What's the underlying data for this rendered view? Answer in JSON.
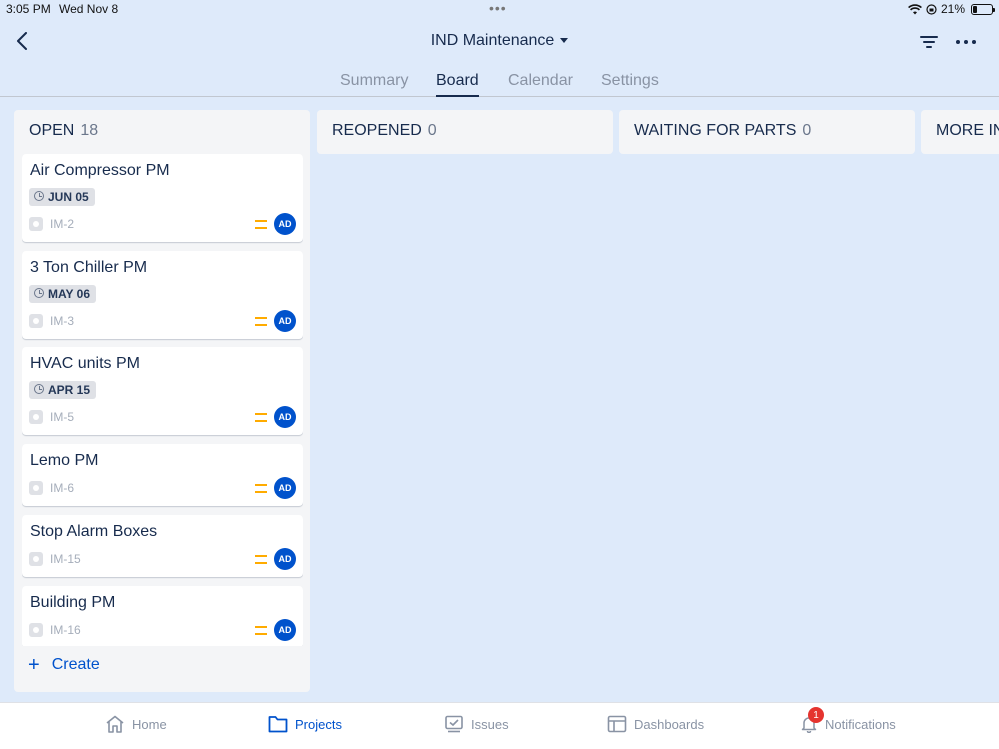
{
  "status_bar": {
    "time": "3:05 PM",
    "date": "Wed Nov 8",
    "dots": "•••",
    "battery_text": "21%",
    "battery_level": 0.21
  },
  "header": {
    "title": "IND Maintenance",
    "back_icon": "chevron-left-icon",
    "filter_icon": "filter-icon",
    "more_icon": "more-horizontal-icon"
  },
  "tabs": [
    {
      "label": "Summary",
      "active": false
    },
    {
      "label": "Board",
      "active": true
    },
    {
      "label": "Calendar",
      "active": false
    },
    {
      "label": "Settings",
      "active": false
    }
  ],
  "columns": [
    {
      "name": "OPEN",
      "count": "18",
      "cards": [
        {
          "title": "Air Compressor PM",
          "due": "JUN 05",
          "key": "IM-2",
          "assignee": "AD"
        },
        {
          "title": "3 Ton Chiller PM",
          "due": "MAY 06",
          "key": "IM-3",
          "assignee": "AD"
        },
        {
          "title": "HVAC units PM",
          "due": "APR 15",
          "key": "IM-5",
          "assignee": "AD"
        },
        {
          "title": "Lemo PM",
          "due": "",
          "key": "IM-6",
          "assignee": "AD"
        },
        {
          "title": "Stop Alarm Boxes",
          "due": "",
          "key": "IM-15",
          "assignee": "AD"
        },
        {
          "title": "Building PM",
          "due": "",
          "key": "IM-16",
          "assignee": "AD"
        }
      ],
      "create_label": "Create"
    },
    {
      "name": "REOPENED",
      "count": "0"
    },
    {
      "name": "WAITING FOR PARTS",
      "count": "0"
    },
    {
      "name": "MORE IN",
      "count": ""
    }
  ],
  "bottom_nav": [
    {
      "label": "Home",
      "icon": "home-icon",
      "active": false
    },
    {
      "label": "Projects",
      "icon": "folder-icon",
      "active": true
    },
    {
      "label": "Issues",
      "icon": "issues-icon",
      "active": false
    },
    {
      "label": "Dashboards",
      "icon": "dashboard-icon",
      "active": false
    },
    {
      "label": "Notifications",
      "icon": "bell-icon",
      "active": false,
      "badge": "1"
    }
  ],
  "colors": {
    "background": "#deeafa",
    "column": "#f4f5f7",
    "accent": "#0052cc",
    "priority_medium": "#ffab00",
    "badge": "#e5342f"
  }
}
